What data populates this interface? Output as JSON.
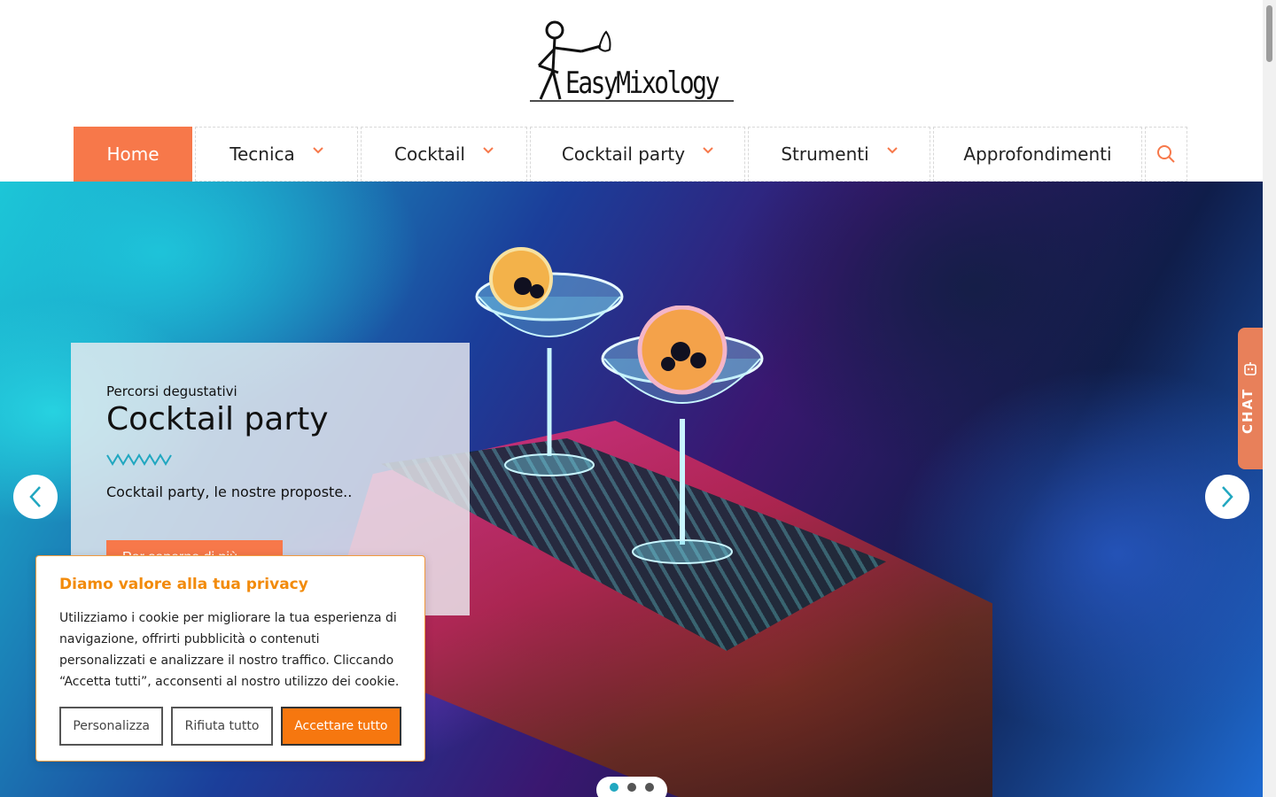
{
  "site": {
    "logo_text": "EasyMixology"
  },
  "nav": {
    "items": [
      {
        "label": "Home",
        "active": true,
        "dropdown": false
      },
      {
        "label": "Tecnica",
        "active": false,
        "dropdown": true
      },
      {
        "label": "Cocktail",
        "active": false,
        "dropdown": true
      },
      {
        "label": "Cocktail party",
        "active": false,
        "dropdown": true
      },
      {
        "label": "Strumenti",
        "active": false,
        "dropdown": true
      },
      {
        "label": "Approfondimenti",
        "active": false,
        "dropdown": false
      }
    ],
    "search_icon": "search-icon"
  },
  "hero": {
    "eyebrow": "Percorsi degustativi",
    "title": "Cocktail party",
    "description": "Cocktail party, le nostre proposte..",
    "cta_label": "Per saperne di più",
    "slides_total": 3,
    "active_slide": 1
  },
  "chat": {
    "label": "CHAT"
  },
  "cookie": {
    "title": "Diamo valore alla tua privacy",
    "text": "Utilizziamo i cookie per migliorare la tua esperienza di navigazione, offrirti pubblicità o contenuti personalizzati e analizzare il nostro traffico. Cliccando “Accetta tutti”, acconsenti al nostro utilizzo dei cookie.",
    "customize_label": "Personalizza",
    "reject_label": "Rifiuta tutto",
    "accept_label": "Accettare tutto"
  },
  "colors": {
    "accent": "#f7784a",
    "cookie_accent": "#f28b0c",
    "teal": "#21a7c0"
  }
}
